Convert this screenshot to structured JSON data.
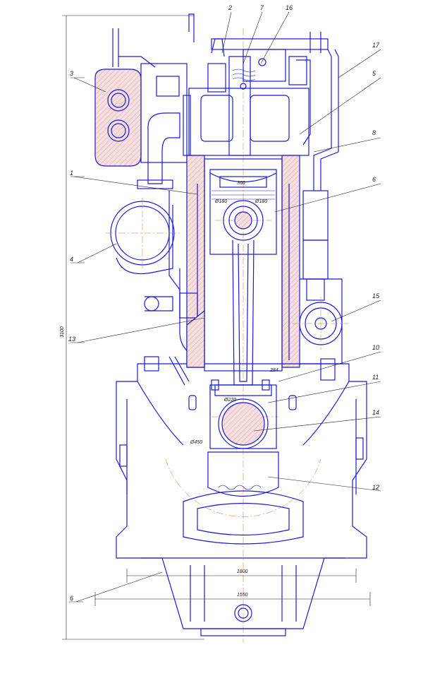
{
  "callouts": [
    "1",
    "2",
    "3",
    "4",
    "5",
    "6",
    "7",
    "8",
    "10",
    "11",
    "12",
    "13",
    "14",
    "15",
    "16",
    "17",
    "6"
  ],
  "dimensions": {
    "overall_height": "3100",
    "piston_width": "360",
    "pin_diameter": "Ø180",
    "bore_left": "Ø180",
    "crank_pin": "Ø220",
    "crank_radius": "Ø450",
    "offset": "284",
    "base_width": "1800",
    "foot_width": "1550"
  },
  "colors": {
    "outline": "#1a1ad6",
    "centerline": "#e06a1a",
    "text": "#222222"
  }
}
